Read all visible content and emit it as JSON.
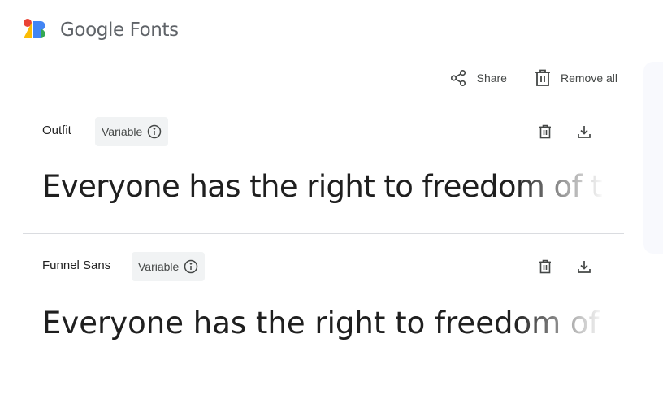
{
  "header": {
    "brand": "Google Fonts",
    "logo_icon": "google-fonts-logo",
    "logo_colors": {
      "red": "#ea4335",
      "yellow": "#fbbc04",
      "blue": "#4285f4",
      "green": "#34a853"
    }
  },
  "toolbar": {
    "share_label": "Share",
    "share_icon": "share-icon",
    "remove_all_label": "Remove all",
    "remove_all_icon": "trash-icon"
  },
  "fonts": [
    {
      "name": "Outfit",
      "badge": "Variable",
      "sample_text": "Everyone has the right to freedom of thought",
      "icons": [
        "info-icon",
        "trash-icon",
        "download-icon"
      ]
    },
    {
      "name": "Funnel Sans",
      "badge": "Variable",
      "sample_text": "Everyone has the right to freedom of thought",
      "icons": [
        "info-icon",
        "trash-icon",
        "download-icon"
      ]
    }
  ],
  "colors": {
    "text": "#1f1f1f",
    "muted": "#444746",
    "chip_bg": "#f1f3f4",
    "divider": "#dadce0"
  }
}
